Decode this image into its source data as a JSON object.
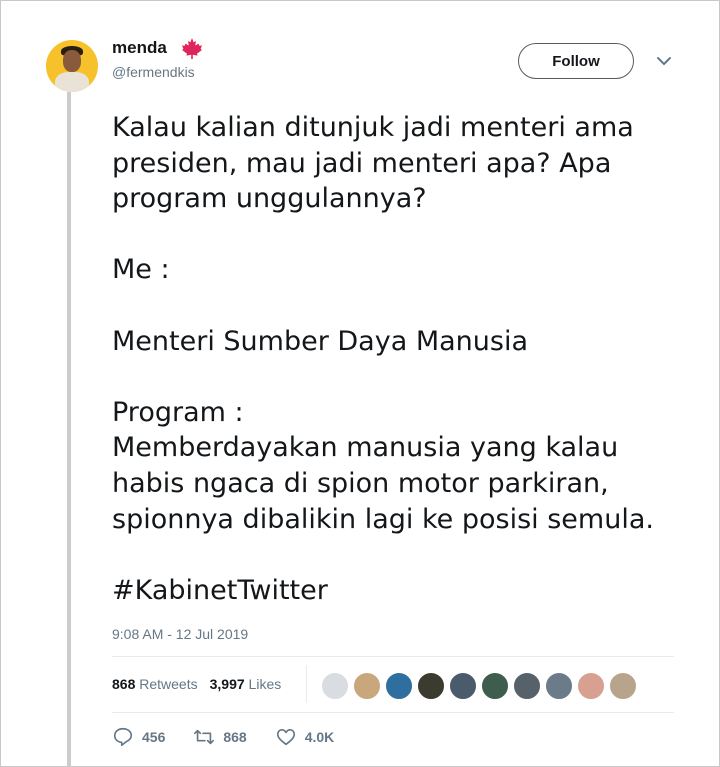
{
  "user": {
    "name": "menda",
    "handle": "@fermendkis",
    "badge_icon": "maple-leaf-icon"
  },
  "follow_label": "Follow",
  "tweet": {
    "paragraphs": [
      "Kalau kalian ditunjuk jadi menteri ama\npresiden, mau jadi menteri apa? Apa\nprogram unggulannya?",
      "Me :",
      "Menteri Sumber Daya Manusia",
      "Program :\nMemberdayakan manusia yang kalau\nhabis ngaca di spion motor parkiran,\nspionnya dibalikin lagi ke posisi semula."
    ],
    "hashtag": "#KabinetTwitter"
  },
  "timestamp": "9:08 AM - 12 Jul 2019",
  "stats": {
    "retweets_count": "868",
    "retweets_label": "Retweets",
    "likes_count": "3,997",
    "likes_label": "Likes"
  },
  "likers_colors": [
    "#d9dde2",
    "#c9a77c",
    "#2f6fa0",
    "#3b3b2f",
    "#4a5b6c",
    "#3f5d4f",
    "#57616a",
    "#6b7b8a",
    "#d8a090",
    "#b8a48a"
  ],
  "actions": {
    "reply_count": "456",
    "retweet_count": "868",
    "like_count": "4.0K"
  },
  "colors": {
    "text": "#14171a",
    "secondary": "#657786",
    "accent_leaf": "#e0245e"
  }
}
